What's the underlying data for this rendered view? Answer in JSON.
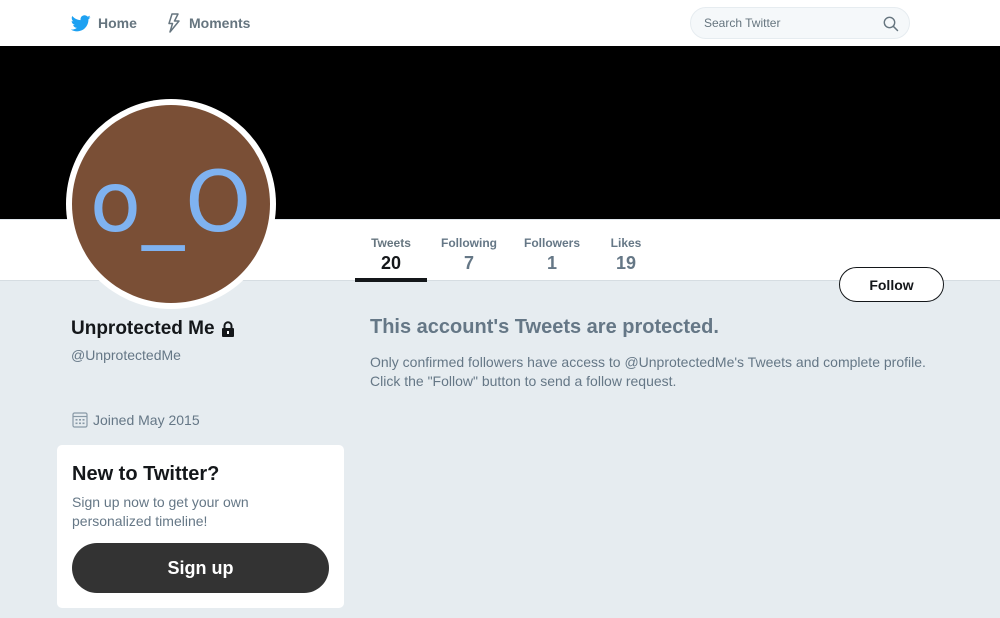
{
  "nav": {
    "home_label": "Home",
    "moments_label": "Moments",
    "search_placeholder": "Search Twitter"
  },
  "profile": {
    "avatar_text": "o_O",
    "name": "Unprotected Me",
    "handle": "@UnprotectedMe",
    "joined": "Joined May 2015"
  },
  "stats": [
    {
      "label": "Tweets",
      "value": "20"
    },
    {
      "label": "Following",
      "value": "7"
    },
    {
      "label": "Followers",
      "value": "1"
    },
    {
      "label": "Likes",
      "value": "19"
    }
  ],
  "follow_label": "Follow",
  "protected": {
    "title": "This account's Tweets are protected.",
    "line1": "Only confirmed followers have access to @UnprotectedMe's Tweets and complete profile.",
    "line2": "Click the \"Follow\" button to send a follow request."
  },
  "signup": {
    "title": "New to Twitter?",
    "text": "Sign up now to get your own personalized timeline!",
    "button_label": "Sign up"
  },
  "colors": {
    "accent": "#1da1f2",
    "banner": "#000000",
    "avatar_bg": "#7a4f36",
    "avatar_face": "#7fb2f0",
    "page_bg": "#e6ecf0",
    "signup_button": "#333333"
  },
  "icons": {
    "home": "twitter-bird-icon",
    "moments": "lightning-icon",
    "search": "search-icon",
    "lock": "lock-icon",
    "calendar": "calendar-icon"
  }
}
